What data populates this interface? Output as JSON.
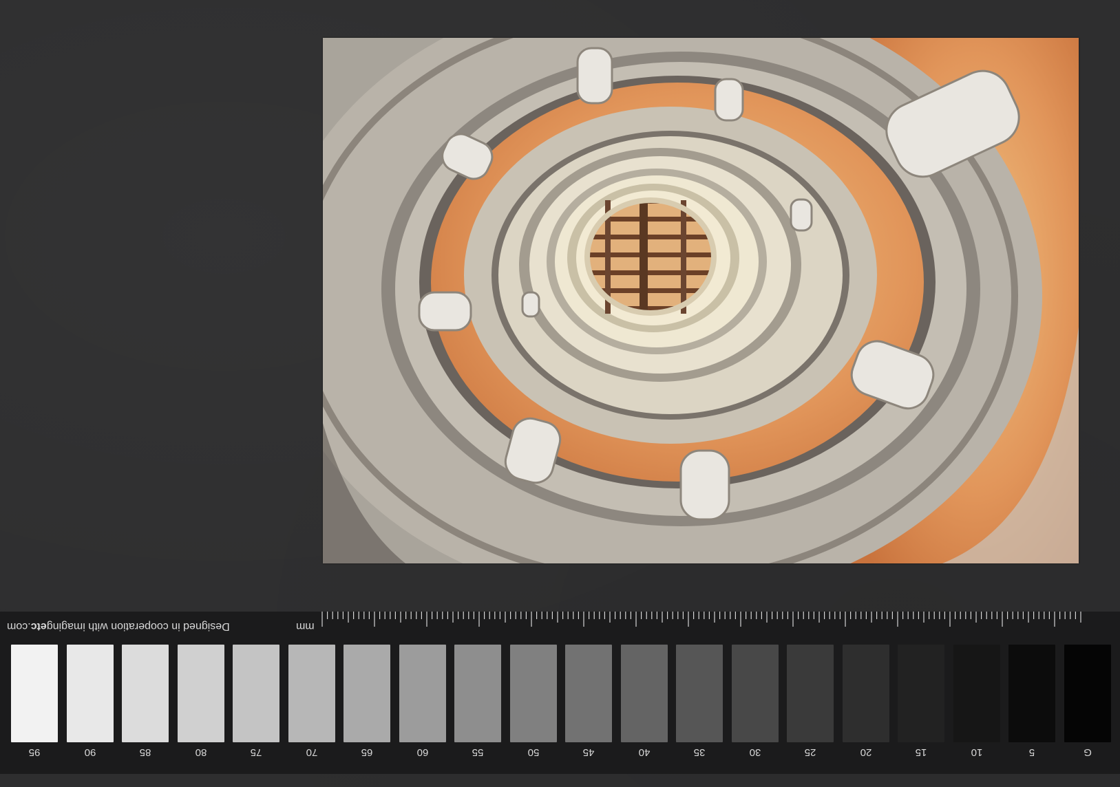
{
  "photo": {
    "subject": "spiral staircase",
    "colors": {
      "orange": "#d9864a",
      "stone": "#b8b3a9",
      "dark_stone": "#6f6862",
      "beam": "#5a3a24",
      "light_wood": "#e7b985"
    }
  },
  "ruler": {
    "credit_prefix": "Designed in cooperation with imaging",
    "credit_bold": "etc",
    "credit_suffix": ".com",
    "unit": "mm"
  },
  "grayscale": {
    "labels": [
      "95",
      "90",
      "85",
      "80",
      "75",
      "70",
      "65",
      "60",
      "55",
      "50",
      "45",
      "40",
      "35",
      "30",
      "25",
      "20",
      "15",
      "10",
      "5",
      "G"
    ],
    "colors": [
      "#f2f2f2",
      "#e8e8e8",
      "#dcdcdc",
      "#d0d0d0",
      "#c4c4c4",
      "#b7b7b7",
      "#aaaaaa",
      "#9c9c9c",
      "#8e8e8e",
      "#808080",
      "#727272",
      "#646464",
      "#565656",
      "#484848",
      "#3a3a3a",
      "#2e2e2e",
      "#222222",
      "#161616",
      "#0c0c0c",
      "#050505"
    ]
  }
}
